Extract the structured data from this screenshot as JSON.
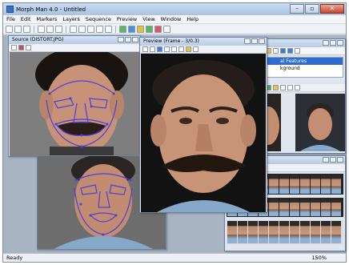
{
  "window": {
    "title": "Morph Man 4.0 - Untitled"
  },
  "menu": [
    "File",
    "Edit",
    "Markers",
    "Layers",
    "Sequence",
    "Preview",
    "View",
    "Window",
    "Help"
  ],
  "source_window": {
    "title": "Source (DISTORT.JPG)"
  },
  "preview_window": {
    "title": "Preview (Frame - 3/0.3)"
  },
  "layers_panel": {
    "items": [
      "al Features",
      "kground"
    ]
  },
  "status": {
    "text": "Ready",
    "zoom": "150%"
  },
  "colors": {
    "title_bar": "#b7cbe4",
    "selection": "#2f6bd1",
    "markers": "#4a3fe0"
  }
}
